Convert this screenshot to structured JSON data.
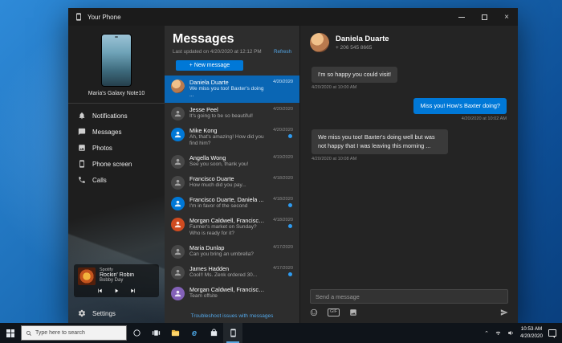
{
  "window": {
    "title": "Your Phone"
  },
  "sidebar": {
    "device_name": "Maria's Galaxy Note10",
    "items": [
      {
        "label": "Notifications"
      },
      {
        "label": "Messages"
      },
      {
        "label": "Photos"
      },
      {
        "label": "Phone screen"
      },
      {
        "label": "Calls"
      }
    ],
    "player": {
      "app": "Spotify",
      "track": "Rockin' Robin",
      "artist": "Bobby Day"
    },
    "settings_label": "Settings"
  },
  "messages_panel": {
    "title": "Messages",
    "last_updated": "Last updated on 4/20/2020 at 12:12 PM",
    "refresh_label": "Refresh",
    "new_message_label": "+ New message",
    "troubleshoot_label": "Troubleshoot issues with messages",
    "conversations": [
      {
        "name": "Daniela Duarte",
        "preview": "We miss you too! Baxter's doing ...",
        "date": "4/20/2020",
        "unread": false,
        "selected": true
      },
      {
        "name": "Jesse Peel",
        "preview": "It's going to be so beautiful!",
        "date": "4/20/2020",
        "unread": false
      },
      {
        "name": "Mike Kong",
        "preview": "Ah, that's amazing! How did you find him?",
        "date": "4/20/2020",
        "unread": true
      },
      {
        "name": "Angella Wong",
        "preview": "See you soon, thank you!",
        "date": "4/19/2020",
        "unread": false
      },
      {
        "name": "Francisco Duarte",
        "preview": "How much did you pay...",
        "date": "4/18/2020",
        "unread": false
      },
      {
        "name": "Francisco Duarte, Daniela ...",
        "preview": "I'm in favor of the second",
        "date": "4/18/2020",
        "unread": true
      },
      {
        "name": "Morgan Caldwell, Francisco ...",
        "preview": "Farmer's market on Sunday? Who is ready for it?",
        "date": "4/18/2020",
        "unread": true
      },
      {
        "name": "Maria Dunlap",
        "preview": "Can you bring an umbrella?",
        "date": "4/17/2020",
        "unread": false
      },
      {
        "name": "James Hadden",
        "preview": "Cool!! Ms. Zenk ordered 30...",
        "date": "4/17/2020",
        "unread": true
      },
      {
        "name": "Morgan Caldwell, Francisco ...",
        "preview": "Team offsite",
        "date": "",
        "unread": false
      }
    ]
  },
  "chat": {
    "contact_name": "Daniela Duarte",
    "contact_phone": "+ 206 545 8665",
    "messages": [
      {
        "direction": "in",
        "text": "I'm so happy you could visit!",
        "timestamp": "4/20/2020 at 10:00 AM"
      },
      {
        "direction": "out",
        "text": "Miss you! How's Baxter doing?",
        "timestamp": "4/20/2020 at 10:02 AM"
      },
      {
        "direction": "in",
        "text": "We miss you too! Baxter's doing well but was not happy that I was leaving this morning ...",
        "timestamp": "4/20/2020 at 10:08 AM"
      }
    ],
    "composer_placeholder": "Send a message",
    "gif_label": "GIF"
  },
  "taskbar": {
    "search_placeholder": "Type here to search",
    "time": "10:53 AM",
    "date": "4/20/2020"
  },
  "colors": {
    "accent": "#0078d7",
    "selected_conversation": "#0a66b4",
    "sent_bubble": "#0078d7",
    "received_bubble": "#3a3a3a",
    "unread_dot": "#2e9bf0"
  },
  "icons": {
    "app-icon": "phone",
    "minimize-icon": "minimize-line",
    "maximize-icon": "maximize-square",
    "close-icon": "close-x",
    "bell-icon": "bell",
    "message-icon": "speech-bubble",
    "photos-icon": "picture",
    "phone-screen-icon": "phone",
    "calls-icon": "handset",
    "settings-icon": "gear",
    "previous-icon": "skip-previous",
    "play-icon": "play-triangle",
    "next-icon": "skip-next",
    "emoji-icon": "smiley",
    "gif-icon": "gif-badge",
    "image-icon": "picture",
    "send-icon": "paper-plane",
    "start-icon": "windows-logo",
    "search-icon": "magnifier",
    "cortana-icon": "circle",
    "task-view-icon": "task-view",
    "file-explorer-icon": "folder",
    "edge-icon": "edge-e",
    "store-icon": "shopping-bag",
    "your-phone-icon": "phone",
    "chevron-up-icon": "chevron-up",
    "network-icon": "wifi",
    "volume-icon": "speaker",
    "notification-center-icon": "speech-square"
  }
}
